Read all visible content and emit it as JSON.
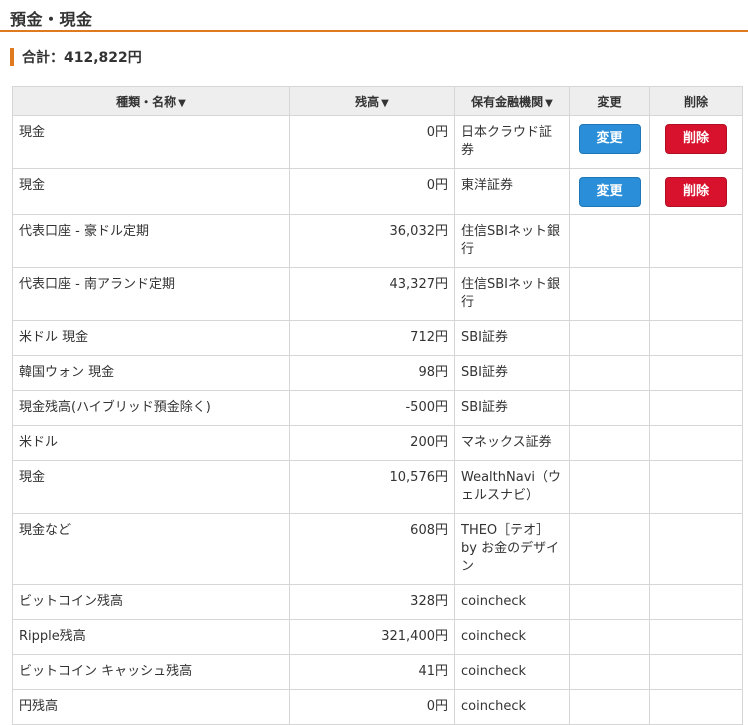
{
  "page": {
    "title": "預金・現金",
    "total_label": "合計：412,822円"
  },
  "table": {
    "headers": {
      "name": "種類・名称",
      "balance": "残高",
      "institution": "保有金融機関",
      "edit": "変更",
      "delete": "削除"
    },
    "sort_icon": "▼",
    "rows": [
      {
        "name": "現金",
        "amount": "0円",
        "institution": "日本クラウド証券",
        "edit": "変更",
        "delete": "削除"
      },
      {
        "name": "現金",
        "amount": "0円",
        "institution": "東洋証券",
        "edit": "変更",
        "delete": "削除"
      },
      {
        "name": "代表口座 - 豪ドル定期",
        "amount": "36,032円",
        "institution": "住信SBIネット銀行"
      },
      {
        "name": "代表口座 - 南アランド定期",
        "amount": "43,327円",
        "institution": "住信SBIネット銀行"
      },
      {
        "name": "米ドル 現金",
        "amount": "712円",
        "institution": "SBI証券"
      },
      {
        "name": "韓国ウォン 現金",
        "amount": "98円",
        "institution": "SBI証券"
      },
      {
        "name": "現金残高(ハイブリッド預金除く)",
        "amount": "-500円",
        "institution": "SBI証券"
      },
      {
        "name": "米ドル",
        "amount": "200円",
        "institution": "マネックス証券"
      },
      {
        "name": "現金",
        "amount": "10,576円",
        "institution": "WealthNavi（ウェルスナビ）"
      },
      {
        "name": "現金など",
        "amount": "608円",
        "institution": "THEO［テオ］ by お金のデザイン"
      },
      {
        "name": "ビットコイン残高",
        "amount": "328円",
        "institution": "coincheck"
      },
      {
        "name": "Ripple残高",
        "amount": "321,400円",
        "institution": "coincheck"
      },
      {
        "name": "ビットコイン キャッシュ残高",
        "amount": "41円",
        "institution": "coincheck"
      },
      {
        "name": "円残高",
        "amount": "0円",
        "institution": "coincheck"
      }
    ]
  }
}
